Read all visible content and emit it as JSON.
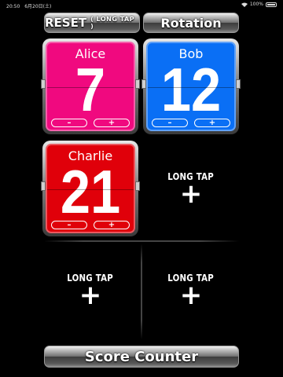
{
  "status_bar": {
    "time": "20:50",
    "date": "6月20日(土)",
    "battery": "100%"
  },
  "header": {
    "reset_label": "RESET",
    "reset_sub": "( LONG TAP )",
    "rotation_label": "Rotation"
  },
  "players": [
    {
      "name": "Alice",
      "score": "7",
      "color": "#f0097f",
      "minus": "–",
      "plus": "+"
    },
    {
      "name": "Bob",
      "score": "12",
      "color": "#0a6ff5",
      "minus": "–",
      "plus": "+"
    },
    {
      "name": "Charlie",
      "score": "21",
      "color": "#e0000a",
      "minus": "–",
      "plus": "+"
    }
  ],
  "empty_slots": [
    {
      "label": "LONG TAP",
      "icon": "plus-icon",
      "symbol": "+"
    },
    {
      "label": "LONG TAP",
      "icon": "plus-icon",
      "symbol": "+"
    },
    {
      "label": "LONG TAP",
      "icon": "plus-icon",
      "symbol": "+"
    }
  ],
  "footer": {
    "title": "Score Counter"
  }
}
